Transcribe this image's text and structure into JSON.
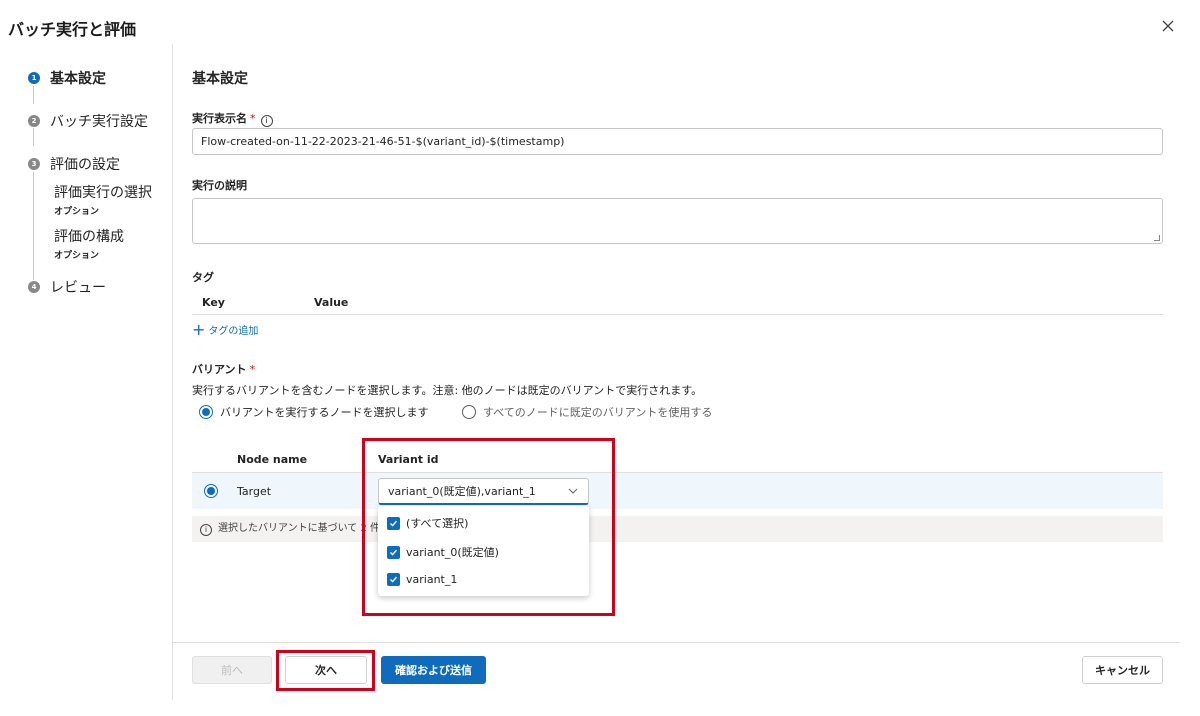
{
  "dialog": {
    "title": "バッチ実行と評価"
  },
  "stepper": {
    "steps": [
      {
        "num": "1",
        "label": "基本設定"
      },
      {
        "num": "2",
        "label": "バッチ実行設定"
      },
      {
        "num": "3",
        "label": "評価の設定"
      },
      {
        "num": "4",
        "label": "レビュー"
      }
    ],
    "substeps": [
      {
        "label": "評価実行の選択",
        "optional": "オプション"
      },
      {
        "label": "評価の構成",
        "optional": "オプション"
      }
    ]
  },
  "main": {
    "section_title": "基本設定",
    "run_name": {
      "label": "実行表示名",
      "required_mark": "*",
      "info_glyph": "i",
      "value": "Flow-created-on-11-22-2023-21-46-51-$(variant_id)-$(timestamp)"
    },
    "run_description": {
      "label": "実行の説明",
      "value": ""
    },
    "tags": {
      "label": "タグ",
      "key_header": "Key",
      "value_header": "Value",
      "add_label": "タグの追加",
      "add_icon": "plus-icon"
    },
    "variants": {
      "label": "バリアント",
      "required_mark": "*",
      "description": "実行するバリアントを含むノードを選択します。注意: 他のノードは既定のバリアントで実行されます。",
      "option_select_nodes": "バリアントを実行するノードを選択します",
      "option_default_all": "すべてのノードに既定のバリアントを使用する",
      "selected_option": "select_nodes",
      "table": {
        "col_node": "Node name",
        "col_variant": "Variant id",
        "rows": [
          {
            "node": "Target",
            "variant_value": "variant_0(既定値),variant_1",
            "selected": true
          }
        ]
      },
      "info_text": "選択したバリアントに基づいて 2 件",
      "dropdown_options": [
        {
          "label": "(すべて選択)",
          "checked": true
        },
        {
          "label": "variant_0(既定値)",
          "checked": true
        },
        {
          "label": "variant_1",
          "checked": true
        }
      ]
    }
  },
  "footer": {
    "prev_label": "前へ",
    "next_label": "次へ",
    "submit_label": "確認および送信",
    "cancel_label": "キャンセル"
  },
  "colors": {
    "accent": "#0f6cbd",
    "highlight_annotation": "#d0021b",
    "required": "#c50f1f"
  }
}
